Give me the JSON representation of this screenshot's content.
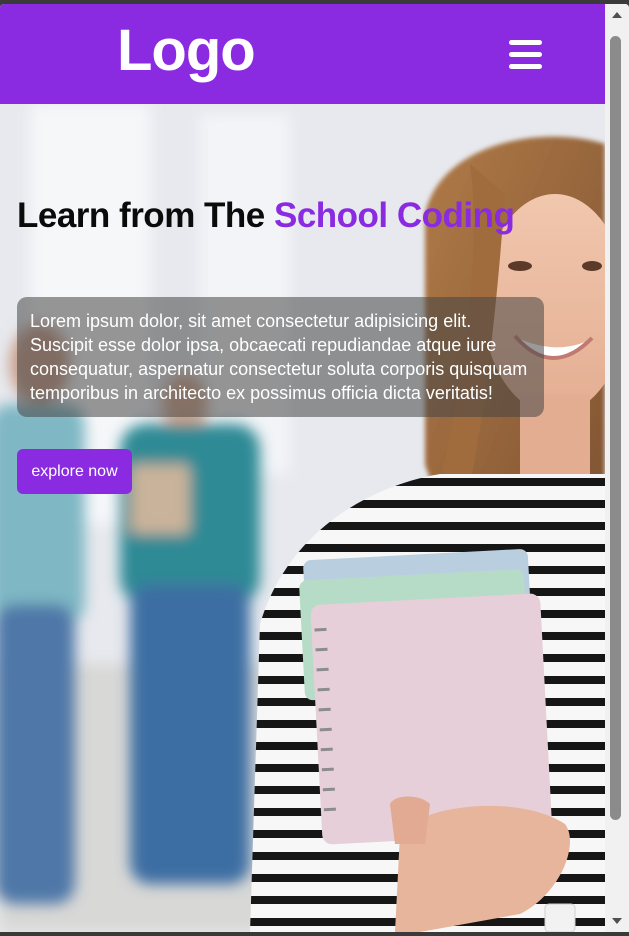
{
  "header": {
    "logo": "Logo",
    "menu_icon": "hamburger-menu-icon"
  },
  "hero": {
    "title_prefix": "Learn from The ",
    "title_accent": "School Coding",
    "body": "Lorem ipsum dolor, sit amet consectetur adipisicing elit. Suscipit esse dolor ipsa, obcaecati repudiandae atque iure consequatur, aspernatur consectetur soluta corporis quisquam temporibus in architecto ex possimus officia dicta veritatis!",
    "button_label": "explore now"
  },
  "colors": {
    "accent": "#8a2be2",
    "header_bg": "#8a2be2",
    "title_text": "#0b0b0b"
  }
}
